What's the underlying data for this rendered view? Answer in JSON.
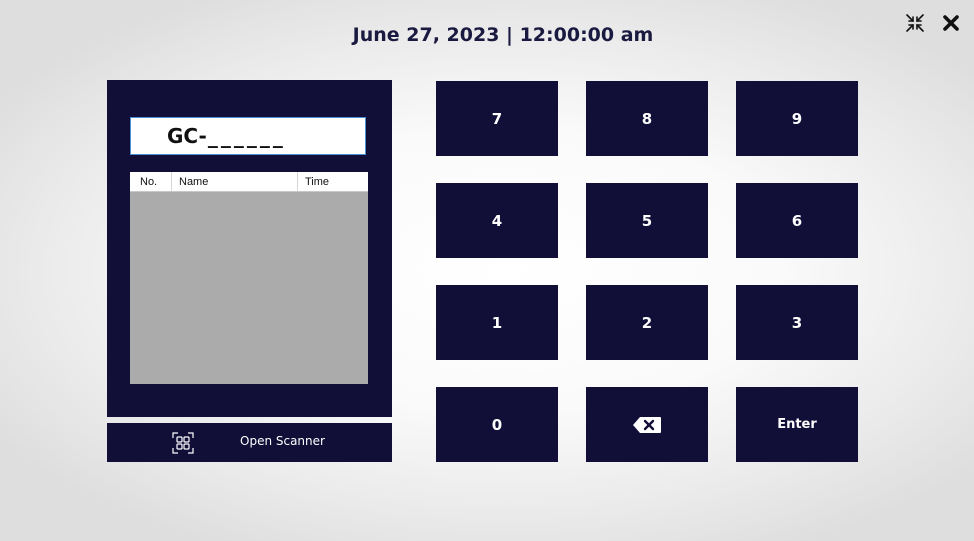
{
  "header": {
    "datetime": "June 27, 2023 | 12:00:00 am"
  },
  "window_controls": {
    "minimize_icon": "collapse-arrows-icon",
    "close_icon": "close-x-icon"
  },
  "code_input": {
    "prefix": "GC-",
    "mask": "______"
  },
  "list": {
    "columns": [
      "No.",
      "Name",
      "Time"
    ],
    "rows": []
  },
  "scanner": {
    "label": "Open Scanner",
    "icon": "qr-scan-icon"
  },
  "keypad": {
    "k7": "7",
    "k8": "8",
    "k9": "9",
    "k4": "4",
    "k5": "5",
    "k6": "6",
    "k1": "1",
    "k2": "2",
    "k3": "3",
    "k0": "0",
    "backspace_icon": "backspace-icon",
    "enter": "Enter"
  },
  "colors": {
    "panel": "#110e38",
    "title": "#1a1a40",
    "list_bg": "#ababab",
    "input_border": "#4b8fd6"
  }
}
